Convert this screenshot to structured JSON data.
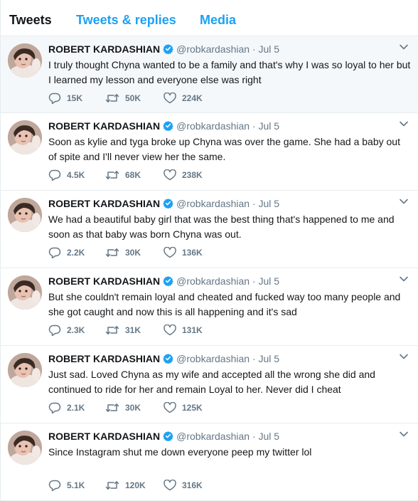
{
  "tabs": [
    {
      "label": "Tweets"
    },
    {
      "label": "Tweets & replies"
    },
    {
      "label": "Media"
    }
  ],
  "colors": {
    "accent": "#1da1f2",
    "muted": "#657786"
  },
  "tweets": [
    {
      "name": "ROBERT KARDASHIAN",
      "handle": "@robkardashian",
      "dot": "·",
      "date": "Jul 5",
      "text": "I truly thought Chyna wanted to be a family and that's why I was so loyal to her but I learned my lesson and everyone else was right",
      "replies": "15K",
      "retweets": "50K",
      "likes": "224K"
    },
    {
      "name": "ROBERT KARDASHIAN",
      "handle": "@robkardashian",
      "dot": "·",
      "date": "Jul 5",
      "text": "Soon as kylie and tyga broke up Chyna was over the game. She had a baby out of spite and I'll never view her the same.",
      "replies": "4.5K",
      "retweets": "68K",
      "likes": "238K"
    },
    {
      "name": "ROBERT KARDASHIAN",
      "handle": "@robkardashian",
      "dot": "·",
      "date": "Jul 5",
      "text": "We had a beautiful baby girl that was the best thing that's happened to me and soon as that baby was born Chyna was out.",
      "replies": "2.2K",
      "retweets": "30K",
      "likes": "136K"
    },
    {
      "name": "ROBERT KARDASHIAN",
      "handle": "@robkardashian",
      "dot": "·",
      "date": "Jul 5",
      "text": "But she couldn't remain loyal and cheated and fucked way too many people and she got caught and now this is all happening and it's sad",
      "replies": "2.3K",
      "retweets": "31K",
      "likes": "131K"
    },
    {
      "name": "ROBERT KARDASHIAN",
      "handle": "@robkardashian",
      "dot": "·",
      "date": "Jul 5",
      "text": "Just sad. Loved Chyna as my wife and accepted all the wrong she did and continued to ride for her and remain Loyal to her. Never did I cheat",
      "replies": "2.1K",
      "retweets": "30K",
      "likes": "125K"
    },
    {
      "name": "ROBERT KARDASHIAN",
      "handle": "@robkardashian",
      "dot": "·",
      "date": "Jul 5",
      "text": "Since Instagram shut me down everyone peep my twitter lol",
      "replies": "5.1K",
      "retweets": "120K",
      "likes": "316K"
    }
  ]
}
